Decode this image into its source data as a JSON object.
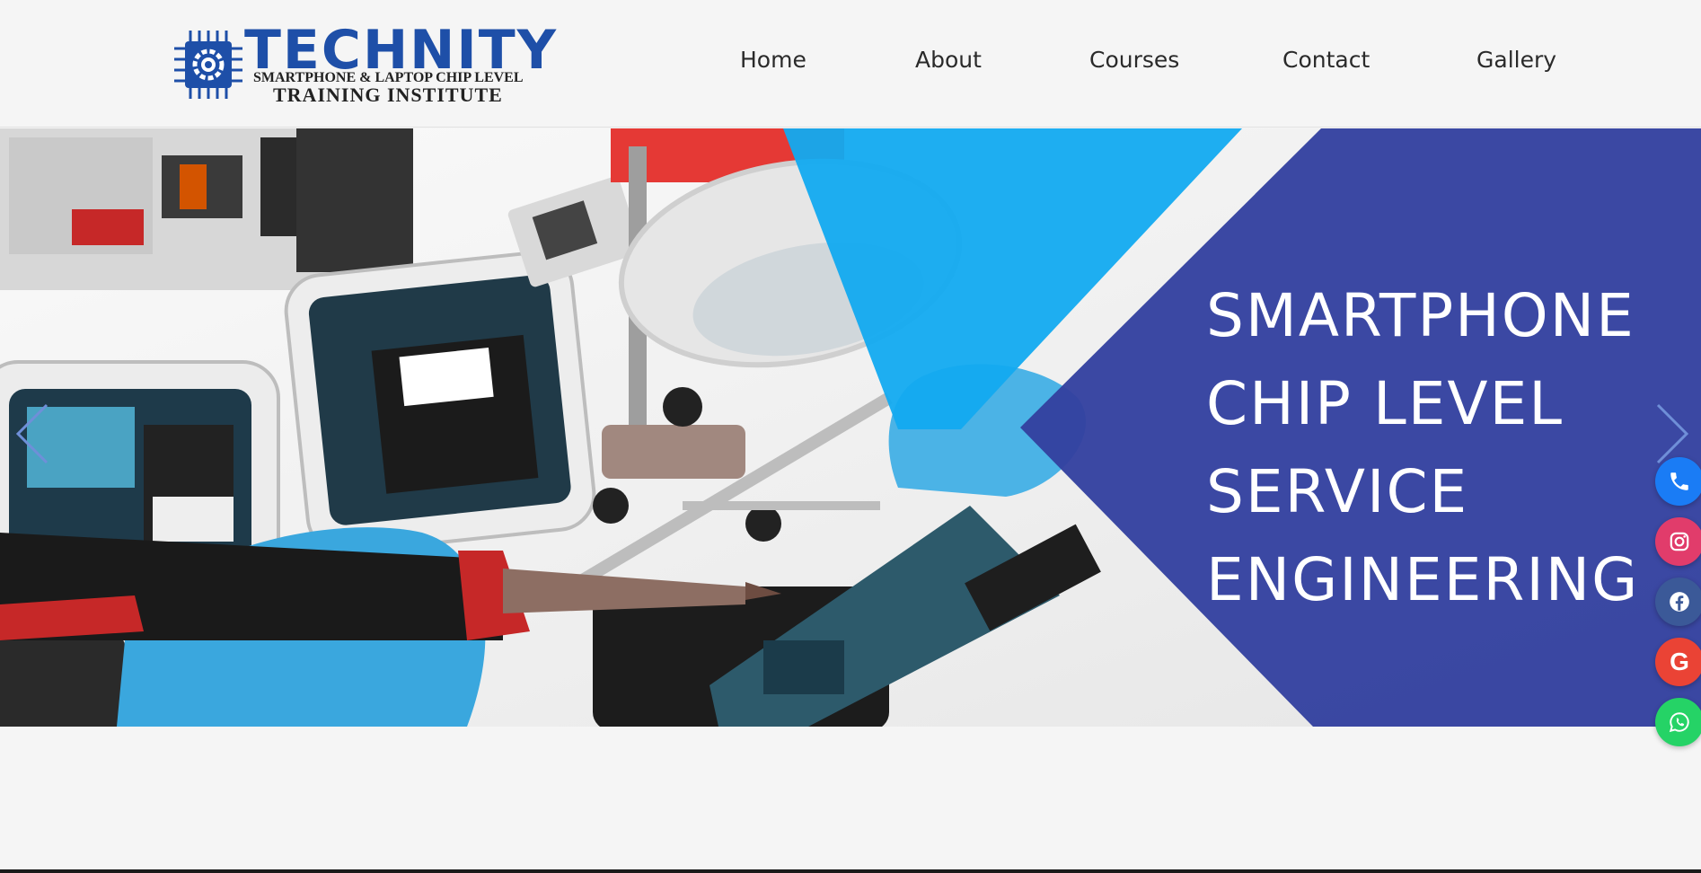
{
  "brand": {
    "name": "TECHNITY",
    "tagline_1": "SMARTPHONE & LAPTOP CHIP LEVEL",
    "tagline_2": "TRAINING INSTITUTE",
    "color": "#1e4fa8"
  },
  "nav": {
    "items": [
      {
        "label": "Home"
      },
      {
        "label": "About"
      },
      {
        "label": "Courses"
      },
      {
        "label": "Contact"
      },
      {
        "label": "Gallery"
      }
    ]
  },
  "hero": {
    "title_lines": [
      "SMARTPHONE",
      "CHIP LEVEL",
      "SERVICE",
      "ENGINEERING"
    ],
    "panel_color": "#33419f",
    "accent_color": "#12aaf0",
    "prev_icon": "chevron-left-icon",
    "next_icon": "chevron-right-icon"
  },
  "social": [
    {
      "name": "phone",
      "icon": "phone-icon",
      "color": "#1a7cf5"
    },
    {
      "name": "instagram",
      "icon": "instagram-icon",
      "color": "#e13c6b"
    },
    {
      "name": "facebook",
      "icon": "facebook-icon",
      "color": "#3b5998"
    },
    {
      "name": "google",
      "icon": "google-icon",
      "color": "#ea4335",
      "glyph": "G"
    },
    {
      "name": "whatsapp",
      "icon": "whatsapp-icon",
      "color": "#25d366"
    }
  ]
}
